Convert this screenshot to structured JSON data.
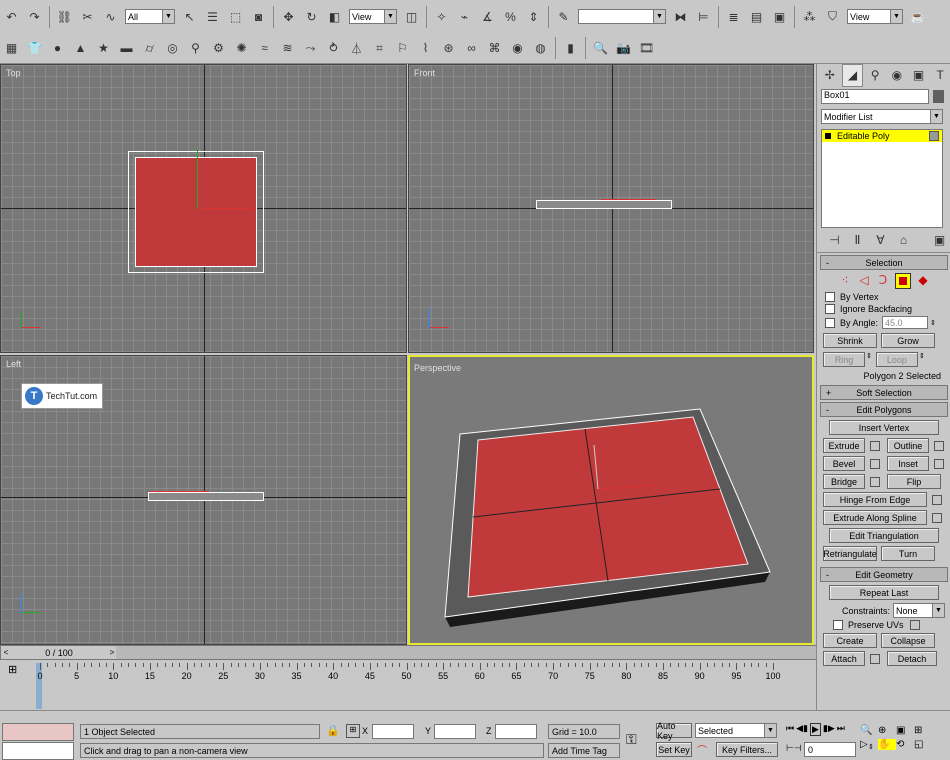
{
  "toolbar": {
    "selection_filter": "All",
    "ref_coord": "View",
    "named_selection": "",
    "render_view": "View"
  },
  "viewports": {
    "top": "Top",
    "front": "Front",
    "left": "Left",
    "perspective": "Perspective"
  },
  "watermark": {
    "logo_letter": "T",
    "text": "TechTut.com"
  },
  "command_panel": {
    "object_name": "Box01",
    "object_color": "#606060",
    "modifier_list": "Modifier List",
    "stack_item": "Editable Poly",
    "selection": {
      "title": "Selection",
      "by_vertex": "By Vertex",
      "ignore_backfacing": "Ignore Backfacing",
      "by_angle": "By Angle:",
      "angle_value": "45.0",
      "shrink": "Shrink",
      "grow": "Grow",
      "ring": "Ring",
      "loop": "Loop",
      "status": "Polygon 2 Selected"
    },
    "soft_selection": "Soft Selection",
    "edit_polygons": {
      "title": "Edit Polygons",
      "insert_vertex": "Insert Vertex",
      "extrude": "Extrude",
      "outline": "Outline",
      "bevel": "Bevel",
      "inset": "Inset",
      "bridge": "Bridge",
      "flip": "Flip",
      "hinge": "Hinge From Edge",
      "extrude_spline": "Extrude Along Spline",
      "edit_triangulation": "Edit Triangulation",
      "retriangulate": "Retriangulate",
      "turn": "Turn"
    },
    "edit_geometry": {
      "title": "Edit Geometry",
      "repeat_last": "Repeat Last",
      "constraints_label": "Constraints:",
      "constraints_value": "None",
      "preserve_uvs": "Preserve UVs",
      "create": "Create",
      "collapse": "Collapse",
      "attach": "Attach",
      "detach": "Detach"
    }
  },
  "timeline": {
    "frame": "0 / 100",
    "ticks": [
      "0",
      "5",
      "10",
      "15",
      "20",
      "25",
      "30",
      "35",
      "40",
      "45",
      "50",
      "55",
      "60",
      "65",
      "70",
      "75",
      "80",
      "85",
      "90",
      "95",
      "100"
    ]
  },
  "status": {
    "selected": "1 Object Selected",
    "prompt": "Click and drag to pan a non-camera view",
    "x_label": "X",
    "y_label": "Y",
    "z_label": "Z",
    "grid": "Grid = 10.0",
    "add_time_tag": "Add Time Tag",
    "auto_key": "Auto Key",
    "set_key": "Set Key",
    "key_mode": "Selected",
    "key_filters": "Key Filters...",
    "current_frame": "0"
  },
  "colors": {
    "poly_red": "#c0393b",
    "selection_yellow": "#ffff00",
    "viewport_bg": "#787878"
  }
}
